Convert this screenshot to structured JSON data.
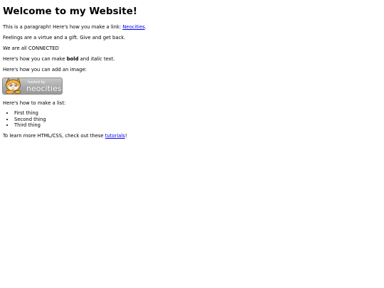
{
  "heading": "Welcome to my Website!",
  "intro": {
    "text": "This is a paragraph! Here's how you make a link: ",
    "link_label": "Neocities",
    "suffix": "."
  },
  "feelings": "Feelings are a virtue and a gift. Give and get back.",
  "connected": "We are all CONNECTED",
  "formatting": {
    "before": "Here's how you can make ",
    "bold": "bold",
    "middle": " and ",
    "italic": "italic",
    "after": " text."
  },
  "image_intro": "Here's how you can add an image:",
  "badge": {
    "hosted_by": "hosted by",
    "brand": "neocities",
    "icon": "neocities-cat-logo"
  },
  "list_intro": "Here's how to make a list:",
  "list_items": [
    "First thing",
    "Second thing",
    "Third thing"
  ],
  "outro": {
    "before": "To learn more HTML/CSS, check out these ",
    "link_label": "tutorials",
    "after": "!"
  },
  "colors": {
    "link": "#0000ee",
    "badge_background": "#a9a9a9",
    "cat_orange": "#f0a030"
  }
}
